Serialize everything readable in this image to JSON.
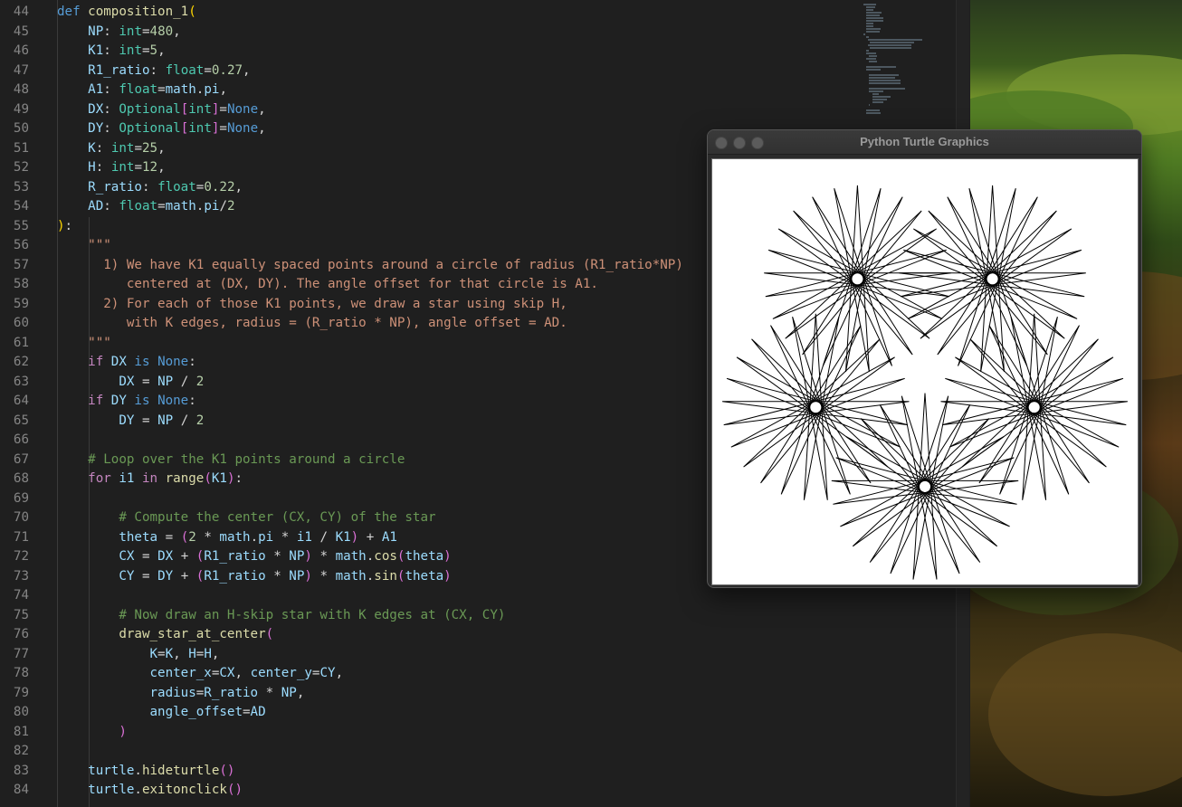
{
  "editor": {
    "first_line": 44,
    "lines": [
      [
        [
          "kw",
          "def "
        ],
        [
          "fn",
          "composition_1"
        ],
        [
          "b1",
          "("
        ]
      ],
      [
        [
          "",
          "    "
        ],
        [
          "param",
          "NP"
        ],
        [
          "",
          ": "
        ],
        [
          "ty",
          "int"
        ],
        [
          "",
          "="
        ],
        [
          "num",
          "480"
        ],
        [
          "",
          ","
        ]
      ],
      [
        [
          "",
          "    "
        ],
        [
          "param",
          "K1"
        ],
        [
          "",
          ": "
        ],
        [
          "ty",
          "int"
        ],
        [
          "",
          "="
        ],
        [
          "num",
          "5"
        ],
        [
          "",
          ","
        ]
      ],
      [
        [
          "",
          "    "
        ],
        [
          "param",
          "R1_ratio"
        ],
        [
          "",
          ": "
        ],
        [
          "ty",
          "float"
        ],
        [
          "",
          "="
        ],
        [
          "num",
          "0.27"
        ],
        [
          "",
          ","
        ]
      ],
      [
        [
          "",
          "    "
        ],
        [
          "param",
          "A1"
        ],
        [
          "",
          ": "
        ],
        [
          "ty",
          "float"
        ],
        [
          "",
          "="
        ],
        [
          "param",
          "math"
        ],
        [
          "",
          "."
        ],
        [
          "param",
          "pi"
        ],
        [
          "",
          ","
        ]
      ],
      [
        [
          "",
          "    "
        ],
        [
          "param",
          "DX"
        ],
        [
          "",
          ": "
        ],
        [
          "ty",
          "Optional"
        ],
        [
          "b2",
          "["
        ],
        [
          "ty",
          "int"
        ],
        [
          "b2",
          "]"
        ],
        [
          "",
          "="
        ],
        [
          "kw",
          "None"
        ],
        [
          "",
          ","
        ]
      ],
      [
        [
          "",
          "    "
        ],
        [
          "param",
          "DY"
        ],
        [
          "",
          ": "
        ],
        [
          "ty",
          "Optional"
        ],
        [
          "b2",
          "["
        ],
        [
          "ty",
          "int"
        ],
        [
          "b2",
          "]"
        ],
        [
          "",
          "="
        ],
        [
          "kw",
          "None"
        ],
        [
          "",
          ","
        ]
      ],
      [
        [
          "",
          "    "
        ],
        [
          "param",
          "K"
        ],
        [
          "",
          ": "
        ],
        [
          "ty",
          "int"
        ],
        [
          "",
          "="
        ],
        [
          "num",
          "25"
        ],
        [
          "",
          ","
        ]
      ],
      [
        [
          "",
          "    "
        ],
        [
          "param",
          "H"
        ],
        [
          "",
          ": "
        ],
        [
          "ty",
          "int"
        ],
        [
          "",
          "="
        ],
        [
          "num",
          "12"
        ],
        [
          "",
          ","
        ]
      ],
      [
        [
          "",
          "    "
        ],
        [
          "param",
          "R_ratio"
        ],
        [
          "",
          ": "
        ],
        [
          "ty",
          "float"
        ],
        [
          "",
          "="
        ],
        [
          "num",
          "0.22"
        ],
        [
          "",
          ","
        ]
      ],
      [
        [
          "",
          "    "
        ],
        [
          "param",
          "AD"
        ],
        [
          "",
          ": "
        ],
        [
          "ty",
          "float"
        ],
        [
          "",
          "="
        ],
        [
          "param",
          "math"
        ],
        [
          "",
          "."
        ],
        [
          "param",
          "pi"
        ],
        [
          "",
          "/"
        ],
        [
          "num",
          "2"
        ]
      ],
      [
        [
          "b1",
          ")"
        ],
        [
          "",
          ":"
        ]
      ],
      [
        [
          "",
          "    "
        ],
        [
          "str",
          "\"\"\""
        ]
      ],
      [
        [
          "",
          "    "
        ],
        [
          "str",
          "  1) We have K1 equally spaced points around a circle of radius (R1_ratio*NP)"
        ]
      ],
      [
        [
          "",
          "    "
        ],
        [
          "str",
          "     centered at (DX, DY). The angle offset for that circle is A1."
        ]
      ],
      [
        [
          "",
          "    "
        ],
        [
          "str",
          "  2) For each of those K1 points, we draw a star using skip H,"
        ]
      ],
      [
        [
          "",
          "    "
        ],
        [
          "str",
          "     with K edges, radius = (R_ratio * NP), angle offset = AD."
        ]
      ],
      [
        [
          "",
          "    "
        ],
        [
          "str",
          "\"\"\""
        ]
      ],
      [
        [
          "",
          "    "
        ],
        [
          "kw2",
          "if "
        ],
        [
          "param",
          "DX"
        ],
        [
          "kw",
          " is "
        ],
        [
          "kw",
          "None"
        ],
        [
          "",
          ":"
        ]
      ],
      [
        [
          "",
          "        "
        ],
        [
          "param",
          "DX"
        ],
        [
          "",
          " = "
        ],
        [
          "param",
          "NP"
        ],
        [
          "",
          " / "
        ],
        [
          "num",
          "2"
        ]
      ],
      [
        [
          "",
          "    "
        ],
        [
          "kw2",
          "if "
        ],
        [
          "param",
          "DY"
        ],
        [
          "kw",
          " is "
        ],
        [
          "kw",
          "None"
        ],
        [
          "",
          ":"
        ]
      ],
      [
        [
          "",
          "        "
        ],
        [
          "param",
          "DY"
        ],
        [
          "",
          " = "
        ],
        [
          "param",
          "NP"
        ],
        [
          "",
          " / "
        ],
        [
          "num",
          "2"
        ]
      ],
      [
        [
          "",
          ""
        ]
      ],
      [
        [
          "",
          "    "
        ],
        [
          "cm",
          "# Loop over the K1 points around a circle"
        ]
      ],
      [
        [
          "",
          "    "
        ],
        [
          "kw2",
          "for "
        ],
        [
          "param",
          "i1"
        ],
        [
          "kw2",
          " in "
        ],
        [
          "fn",
          "range"
        ],
        [
          "b2",
          "("
        ],
        [
          "param",
          "K1"
        ],
        [
          "b2",
          ")"
        ],
        [
          "",
          ":"
        ]
      ],
      [
        [
          "",
          ""
        ]
      ],
      [
        [
          "",
          "        "
        ],
        [
          "cm",
          "# Compute the center (CX, CY) of the star"
        ]
      ],
      [
        [
          "",
          "        "
        ],
        [
          "param",
          "theta"
        ],
        [
          "",
          " = "
        ],
        [
          "b2",
          "("
        ],
        [
          "num",
          "2"
        ],
        [
          "",
          " * "
        ],
        [
          "param",
          "math"
        ],
        [
          "",
          "."
        ],
        [
          "param",
          "pi"
        ],
        [
          "",
          " * "
        ],
        [
          "param",
          "i1"
        ],
        [
          "",
          " / "
        ],
        [
          "param",
          "K1"
        ],
        [
          "b2",
          ")"
        ],
        [
          "",
          " + "
        ],
        [
          "param",
          "A1"
        ]
      ],
      [
        [
          "",
          "        "
        ],
        [
          "param",
          "CX"
        ],
        [
          "",
          " = "
        ],
        [
          "param",
          "DX"
        ],
        [
          "",
          " + "
        ],
        [
          "b2",
          "("
        ],
        [
          "param",
          "R1_ratio"
        ],
        [
          "",
          " * "
        ],
        [
          "param",
          "NP"
        ],
        [
          "b2",
          ")"
        ],
        [
          "",
          " * "
        ],
        [
          "param",
          "math"
        ],
        [
          "",
          "."
        ],
        [
          "fn",
          "cos"
        ],
        [
          "b2",
          "("
        ],
        [
          "param",
          "theta"
        ],
        [
          "b2",
          ")"
        ]
      ],
      [
        [
          "",
          "        "
        ],
        [
          "param",
          "CY"
        ],
        [
          "",
          " = "
        ],
        [
          "param",
          "DY"
        ],
        [
          "",
          " + "
        ],
        [
          "b2",
          "("
        ],
        [
          "param",
          "R1_ratio"
        ],
        [
          "",
          " * "
        ],
        [
          "param",
          "NP"
        ],
        [
          "b2",
          ")"
        ],
        [
          "",
          " * "
        ],
        [
          "param",
          "math"
        ],
        [
          "",
          "."
        ],
        [
          "fn",
          "sin"
        ],
        [
          "b2",
          "("
        ],
        [
          "param",
          "theta"
        ],
        [
          "b2",
          ")"
        ]
      ],
      [
        [
          "",
          ""
        ]
      ],
      [
        [
          "",
          "        "
        ],
        [
          "cm",
          "# Now draw an H-skip star with K edges at (CX, CY)"
        ]
      ],
      [
        [
          "",
          "        "
        ],
        [
          "fn",
          "draw_star_at_center"
        ],
        [
          "b2",
          "("
        ]
      ],
      [
        [
          "",
          "            "
        ],
        [
          "param",
          "K"
        ],
        [
          "",
          "="
        ],
        [
          "param",
          "K"
        ],
        [
          "",
          ", "
        ],
        [
          "param",
          "H"
        ],
        [
          "",
          "="
        ],
        [
          "param",
          "H"
        ],
        [
          "",
          ","
        ]
      ],
      [
        [
          "",
          "            "
        ],
        [
          "param",
          "center_x"
        ],
        [
          "",
          "="
        ],
        [
          "param",
          "CX"
        ],
        [
          "",
          ", "
        ],
        [
          "param",
          "center_y"
        ],
        [
          "",
          "="
        ],
        [
          "param",
          "CY"
        ],
        [
          "",
          ","
        ]
      ],
      [
        [
          "",
          "            "
        ],
        [
          "param",
          "radius"
        ],
        [
          "",
          "="
        ],
        [
          "param",
          "R_ratio"
        ],
        [
          "",
          " * "
        ],
        [
          "param",
          "NP"
        ],
        [
          "",
          ","
        ]
      ],
      [
        [
          "",
          "            "
        ],
        [
          "param",
          "angle_offset"
        ],
        [
          "",
          "="
        ],
        [
          "param",
          "AD"
        ]
      ],
      [
        [
          "",
          "        "
        ],
        [
          "b2",
          ")"
        ]
      ],
      [
        [
          "",
          ""
        ]
      ],
      [
        [
          "",
          "    "
        ],
        [
          "param",
          "turtle"
        ],
        [
          "",
          "."
        ],
        [
          "fn",
          "hideturtle"
        ],
        [
          "b2",
          "()"
        ]
      ],
      [
        [
          "",
          "    "
        ],
        [
          "param",
          "turtle"
        ],
        [
          "",
          "."
        ],
        [
          "fn",
          "exitonclick"
        ],
        [
          "b2",
          "()"
        ]
      ]
    ]
  },
  "turtle_window": {
    "title": "Python Turtle Graphics"
  },
  "drawing": {
    "NP": 480,
    "K1": 5,
    "R1_ratio": 0.27,
    "K": 25,
    "H": 12,
    "R_ratio": 0.22,
    "stroke_color": "#000000"
  },
  "colors": {
    "editor_bg": "#1f1f1f",
    "canvas_bg": "#ffffff"
  }
}
